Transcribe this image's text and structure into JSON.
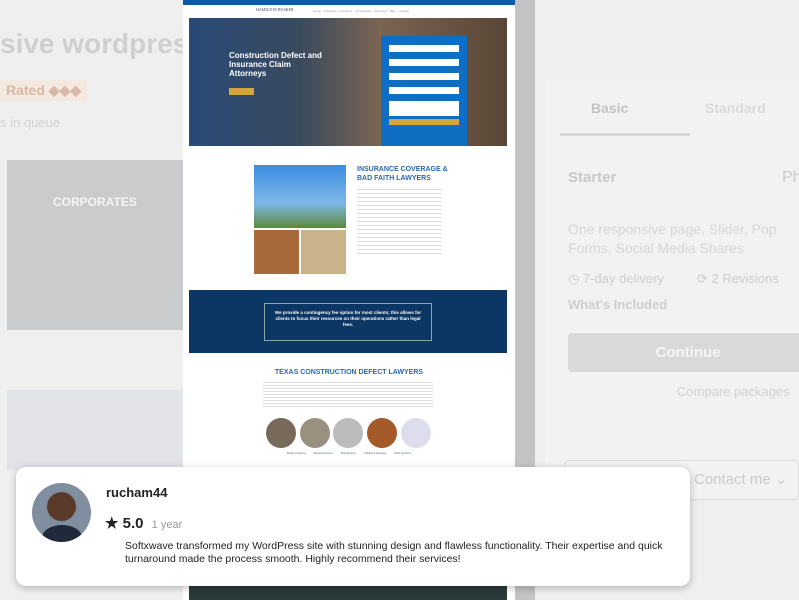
{
  "background": {
    "title_fragment": "sive wordpress",
    "rated_badge": "Rated ◆◆◆",
    "queue_text": "s in queue",
    "thumbnail_caption": "CORPORATES",
    "tabs": [
      "Basic",
      "Standard"
    ],
    "package_name": "Starter",
    "price_fragment": "Ph",
    "description": "One responsive page, Slider, Pop Forms, Social Media Shares",
    "delivery": "7-day delivery",
    "revisions": "2 Revisions",
    "whats_included": "What's Included",
    "continue_label": "Continue",
    "compare_label": "Compare packages",
    "contact_label": "Contact me"
  },
  "preview": {
    "brand": "HAMILTON BUSKER",
    "hero_title": "Construction Defect and Insurance Claim Attorneys",
    "section_title": "INSURANCE COVERAGE & BAD FAITH LAWYERS",
    "banner_text": "We provide a contingency fee option for most clients; this allows for clients to focus their resources on their operations rather than legal fees.",
    "texas_title": "TEXAS CONSTRUCTION DEFECT LAWYERS",
    "circle_labels": [
      "Roofing Systems",
      "Window Systems",
      "Wall Systems",
      "Grading & Drainage",
      "HVAC Systems"
    ]
  },
  "review": {
    "username": "rucham44",
    "rating": "5.0",
    "time": "1 year",
    "text": "Softxwave transformed my WordPress site with stunning design and flawless functionality. Their expertise and quick turnaround made the process smooth. Highly recommend their services!"
  }
}
